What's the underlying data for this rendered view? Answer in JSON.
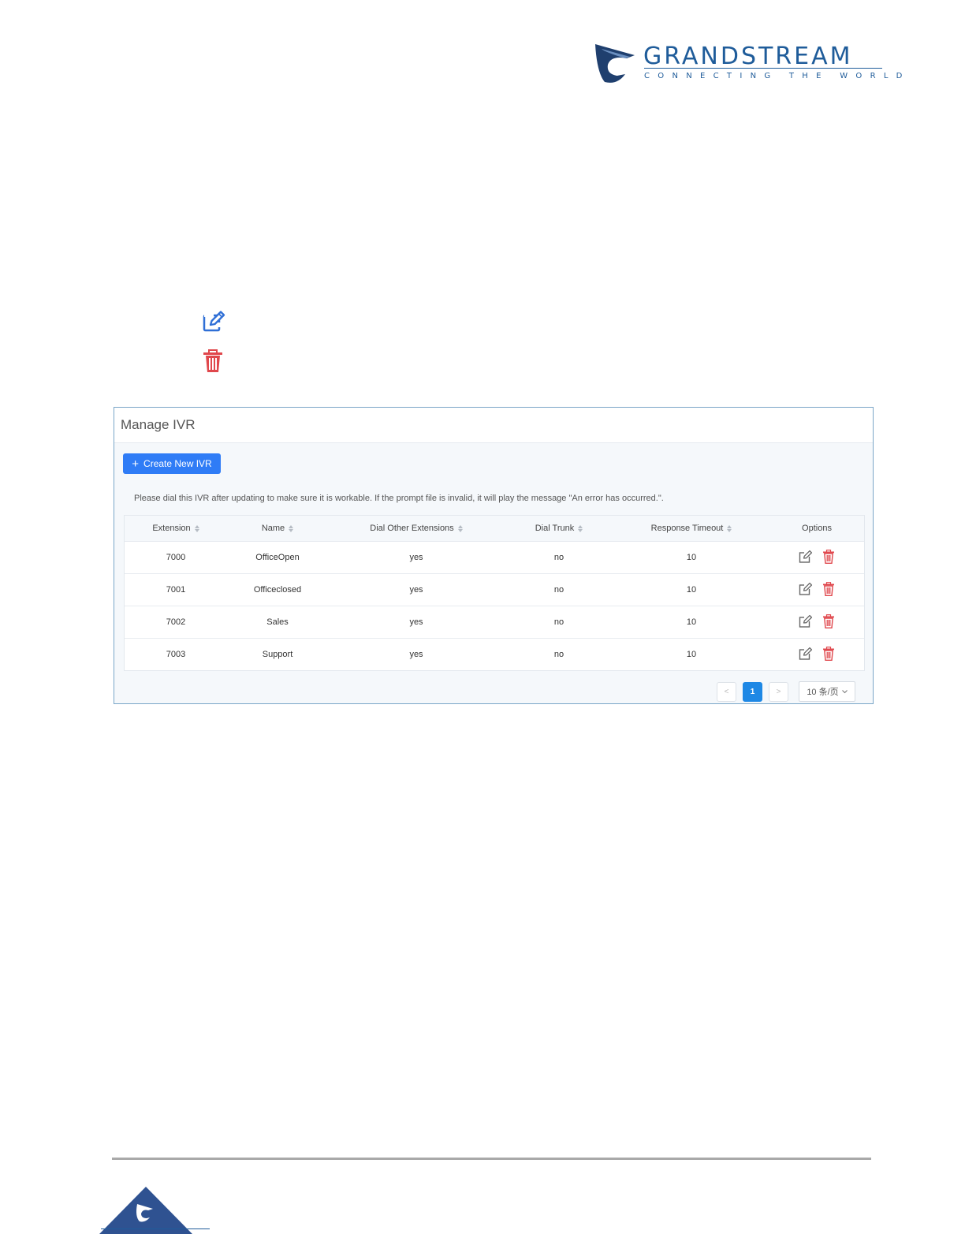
{
  "brand": {
    "name": "GRANDSTREAM",
    "tagline": "CONNECTING THE WORLD",
    "color": "#1f5c9a"
  },
  "doc_icons": [
    "edit-icon",
    "delete-icon"
  ],
  "panel": {
    "title": "Manage IVR",
    "create_button": "Create New IVR",
    "notice": "Please dial this IVR after updating to make sure it is workable. If the prompt file is invalid, it will play the message \"An error has occurred.\".",
    "columns": [
      "Extension",
      "Name",
      "Dial Other Extensions",
      "Dial Trunk",
      "Response Timeout",
      "Options"
    ],
    "rows": [
      {
        "extension": "7000",
        "name": "OfficeOpen",
        "dial_other": "yes",
        "dial_trunk": "no",
        "timeout": "10"
      },
      {
        "extension": "7001",
        "name": "Officeclosed",
        "dial_other": "yes",
        "dial_trunk": "no",
        "timeout": "10"
      },
      {
        "extension": "7002",
        "name": "Sales",
        "dial_other": "yes",
        "dial_trunk": "no",
        "timeout": "10"
      },
      {
        "extension": "7003",
        "name": "Support",
        "dial_other": "yes",
        "dial_trunk": "no",
        "timeout": "10"
      }
    ],
    "pagination": {
      "prev": "<",
      "current_page": "1",
      "next": ">",
      "page_size": "10 条/页"
    }
  },
  "colors": {
    "accent": "#2f7cf6",
    "page_active": "#1e88e5",
    "delete": "#e0474c",
    "edit": "#2f6fd6"
  }
}
